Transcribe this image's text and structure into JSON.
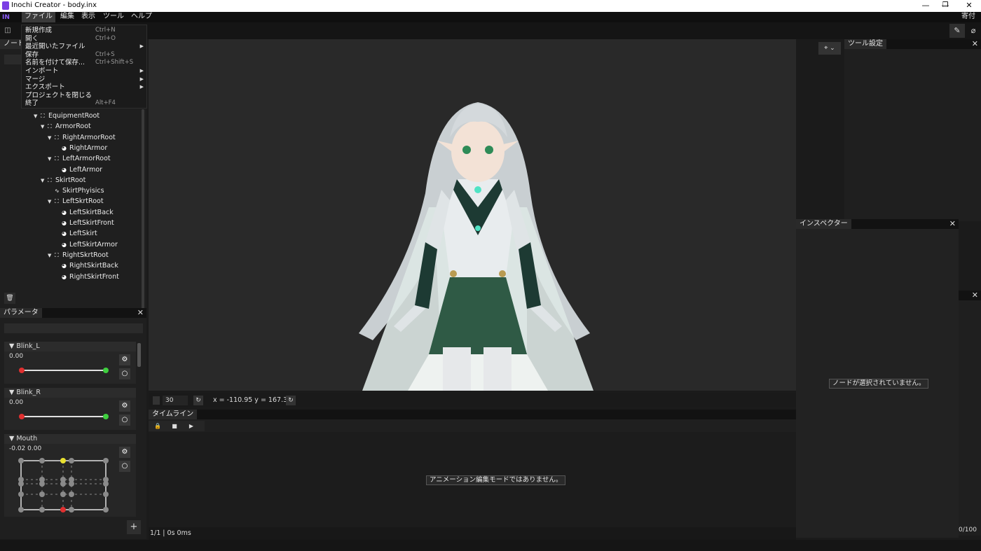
{
  "window": {
    "title": "Inochi Creator - body.inx",
    "controls": [
      "—",
      "❐",
      "✕"
    ]
  },
  "menubar": {
    "logo": "IN",
    "items": [
      "ファイル",
      "編集",
      "表示",
      "ツール",
      "ヘルプ"
    ],
    "donate": "寄付"
  },
  "file_menu": [
    {
      "label": "新規作成",
      "shortcut": "Ctrl+N",
      "submenu": ""
    },
    {
      "label": "開く",
      "shortcut": "Ctrl+O",
      "submenu": ""
    },
    {
      "label": "最近開いたファイル",
      "shortcut": "",
      "submenu": "▶"
    },
    {
      "label": "保存",
      "shortcut": "Ctrl+S",
      "submenu": ""
    },
    {
      "label": "名前を付けて保存...",
      "shortcut": "Ctrl+Shift+S",
      "submenu": ""
    },
    {
      "label": "インポート",
      "shortcut": "",
      "submenu": "▶"
    },
    {
      "label": "マージ",
      "shortcut": "",
      "submenu": "▶"
    },
    {
      "label": "エクスポート",
      "shortcut": "",
      "submenu": "▶"
    },
    {
      "label": "プロジェクトを閉じる",
      "shortcut": "",
      "submenu": ""
    },
    {
      "label": "終了",
      "shortcut": "Alt+F4",
      "submenu": ""
    }
  ],
  "nodes_panel": {
    "tab": "ノード",
    "tree": [
      {
        "label": "EquipmentRoot",
        "depth": 4,
        "arrow": "▼",
        "icon": "composite"
      },
      {
        "label": "ArmorRoot",
        "depth": 5,
        "arrow": "▼",
        "icon": "composite"
      },
      {
        "label": "RightArmorRoot",
        "depth": 6,
        "arrow": "▼",
        "icon": "composite"
      },
      {
        "label": "RightArmor",
        "depth": 7,
        "arrow": "",
        "icon": "part"
      },
      {
        "label": "LeftArmorRoot",
        "depth": 6,
        "arrow": "▼",
        "icon": "composite"
      },
      {
        "label": "LeftArmor",
        "depth": 7,
        "arrow": "",
        "icon": "part"
      },
      {
        "label": "SkirtRoot",
        "depth": 5,
        "arrow": "▼",
        "icon": "composite"
      },
      {
        "label": "SkirtPhyisics",
        "depth": 6,
        "arrow": "",
        "icon": "physics"
      },
      {
        "label": "LeftSkrtRoot",
        "depth": 6,
        "arrow": "▼",
        "icon": "composite"
      },
      {
        "label": "LeftSkirtBack",
        "depth": 7,
        "arrow": "",
        "icon": "part"
      },
      {
        "label": "LeftSkirtFront",
        "depth": 7,
        "arrow": "",
        "icon": "part"
      },
      {
        "label": "LeftSkirt",
        "depth": 7,
        "arrow": "",
        "icon": "part"
      },
      {
        "label": "LeftSkirtArmor",
        "depth": 7,
        "arrow": "",
        "icon": "part"
      },
      {
        "label": "RightSkrtRoot",
        "depth": 6,
        "arrow": "▼",
        "icon": "composite"
      },
      {
        "label": "RightSkirtBack",
        "depth": 7,
        "arrow": "",
        "icon": "part"
      },
      {
        "label": "RightSkirtFront",
        "depth": 7,
        "arrow": "",
        "icon": "part"
      }
    ]
  },
  "params_panel": {
    "tab": "パラメータ",
    "params": [
      {
        "name": "Blink_L",
        "value": "0.00"
      },
      {
        "name": "Blink_R",
        "value": "0.00"
      },
      {
        "name": "Mouth",
        "value": "-0.02 0.00"
      }
    ],
    "add_label": "+"
  },
  "viewport": {
    "zoom_value": "30",
    "coords": "x = -110.95 y = 167.37"
  },
  "timeline": {
    "tab": "タイムライン",
    "message": "アニメーション編集モードではありません。",
    "status": "1/1 | 0s 0ms"
  },
  "tool_settings": {
    "tab": "ツール設定"
  },
  "inspector": {
    "tab": "インスペクター",
    "message": "ノードが選択されていません。"
  },
  "right_counter": "0/100",
  "colors": {
    "accent": "#7b3fe4",
    "knob_red": "#e03030",
    "knob_green": "#3fcf3f",
    "knob_yellow": "#e8e030",
    "knob_grey": "#8a8a8a"
  }
}
